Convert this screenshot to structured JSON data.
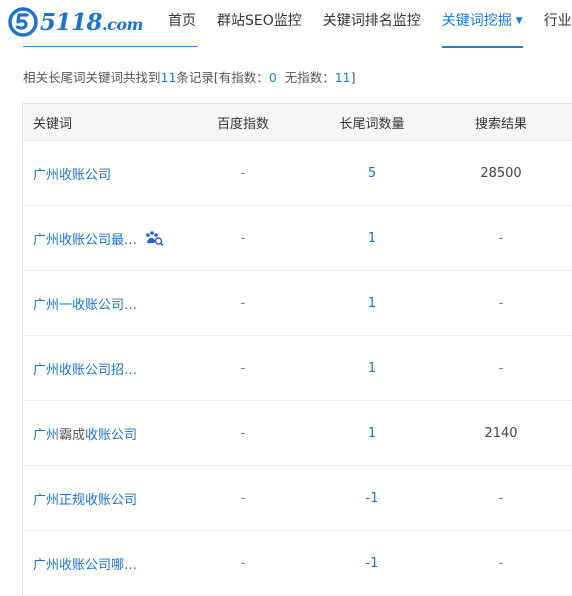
{
  "header": {
    "logo": {
      "main": "5118",
      "suffix": ".com"
    },
    "nav": [
      {
        "label": "首页",
        "active": false
      },
      {
        "label": "群站SEO监控",
        "active": false
      },
      {
        "label": "关键词排名监控",
        "active": false
      },
      {
        "label": "关键词挖掘",
        "active": true,
        "dropdown": true
      },
      {
        "label": "行业词",
        "active": false
      }
    ]
  },
  "summary": {
    "prefix": "相关长尾词关键词共找到",
    "total": "11",
    "mid1": "条记录[有指数：",
    "with_index": "0",
    "mid2": "  无指数：",
    "without_index": "11",
    "suffix": "]"
  },
  "table": {
    "headers": [
      "关键词",
      "百度指数",
      "长尾词数量",
      "搜索结果"
    ],
    "rows": [
      {
        "keyword": "广州收账公司",
        "index": "-",
        "longtail": "5",
        "results": "28500"
      },
      {
        "keyword": "广州收账公司最…",
        "index": "-",
        "longtail": "1",
        "results": "-",
        "icon": "baidu-search-icon"
      },
      {
        "keyword": "广州一收账公司…",
        "index": "-",
        "longtail": "1",
        "results": "-"
      },
      {
        "keyword": "广州收账公司招…",
        "index": "-",
        "longtail": "1",
        "results": "-"
      },
      {
        "keyword": "广州",
        "keyword_gray": "霸成",
        "keyword_tail": "收账公司",
        "index": "-",
        "longtail": "1",
        "results": "2140"
      },
      {
        "keyword": "广州正规收账公司",
        "index": "-",
        "longtail": "-1",
        "results": "-"
      },
      {
        "keyword": "广州收账公司哪…",
        "index": "-",
        "longtail": "-1",
        "results": "-"
      }
    ]
  },
  "colors": {
    "accent": "#1f7bd6",
    "link": "#1f72c9",
    "header_bg": "#f5f6f8"
  }
}
